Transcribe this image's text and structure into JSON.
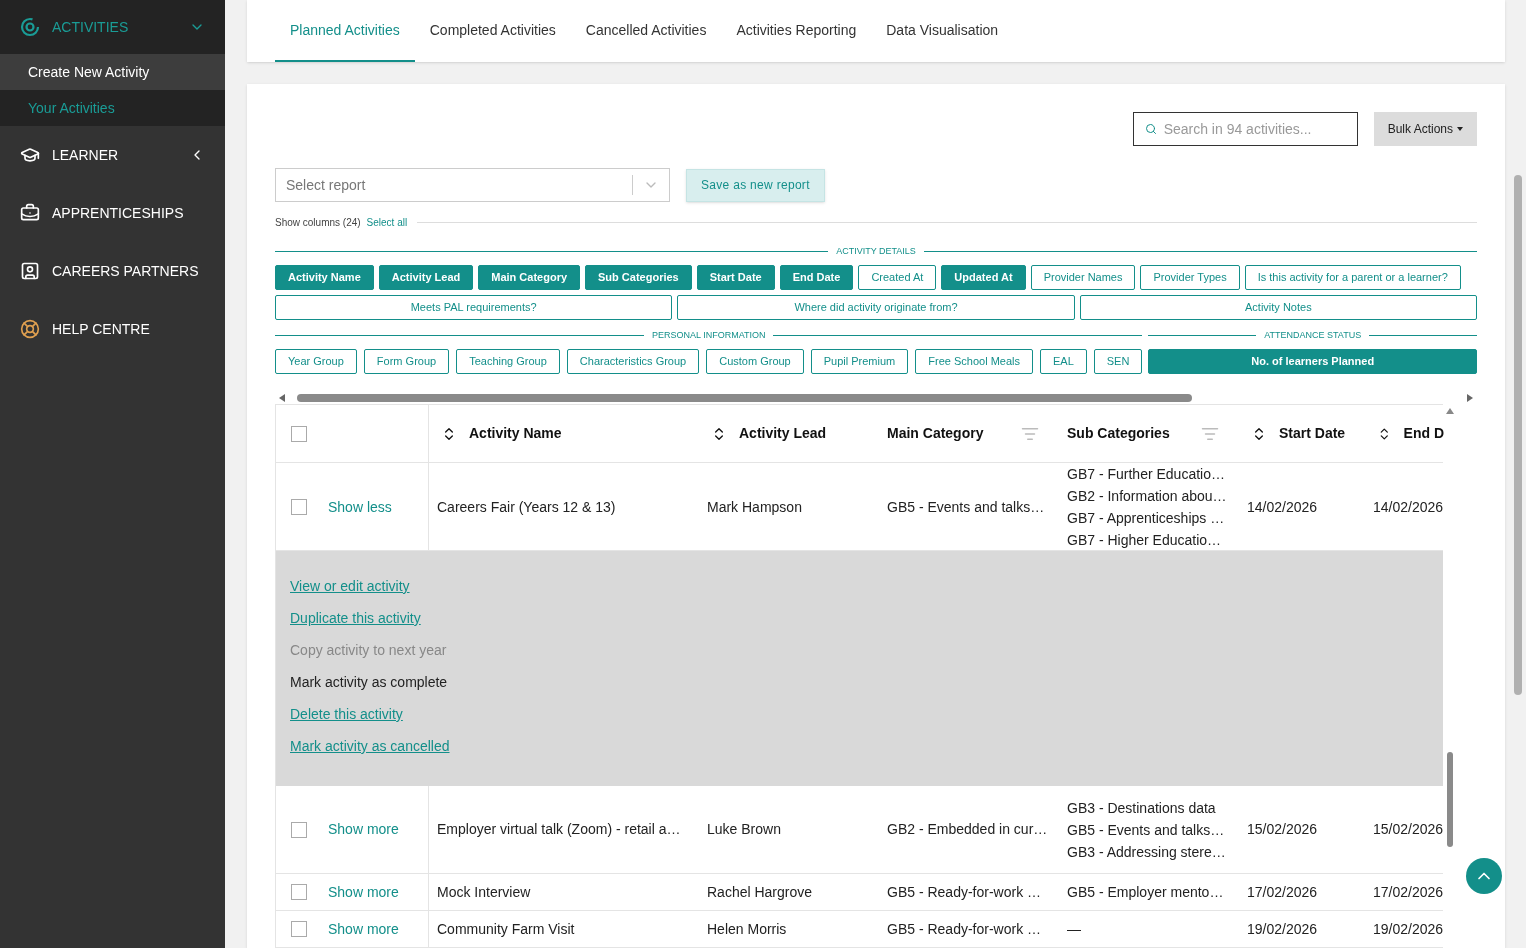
{
  "sidebar": {
    "sections": [
      {
        "label": "ACTIVITIES",
        "kind": "activities",
        "expanded": true,
        "children": [
          {
            "label": "Create New Activity",
            "selected": false
          },
          {
            "label": "Your Activities",
            "selected": true
          }
        ]
      },
      {
        "label": "LEARNER",
        "kind": "learner",
        "expanded": false
      },
      {
        "label": "APPRENTICESHIPS",
        "kind": "apprenticeships"
      },
      {
        "label": "CAREERS PARTNERS",
        "kind": "partners"
      },
      {
        "label": "HELP CENTRE",
        "kind": "help"
      }
    ]
  },
  "tabs": [
    {
      "label": "Planned Activities",
      "selected": true
    },
    {
      "label": "Completed Activities",
      "selected": false
    },
    {
      "label": "Cancelled Activities",
      "selected": false
    },
    {
      "label": "Activities Reporting",
      "selected": false
    },
    {
      "label": "Data Visualisation",
      "selected": false
    }
  ],
  "search": {
    "placeholder": "Search in 94 activities..."
  },
  "bulk_actions": "Bulk Actions",
  "report_select": {
    "placeholder": "Select report"
  },
  "save_report": "Save as new report",
  "show_columns": {
    "label": "Show columns (24)",
    "select_all": "Select all"
  },
  "column_groups": [
    {
      "title": "ACTIVITY DETAILS",
      "rows": [
        {
          "chips": [
            {
              "label": "Activity Name",
              "selected": true
            },
            {
              "label": "Activity Lead",
              "selected": true
            },
            {
              "label": "Main Category",
              "selected": true
            },
            {
              "label": "Sub Categories",
              "selected": true
            },
            {
              "label": "Start Date",
              "selected": true
            },
            {
              "label": "End Date",
              "selected": true
            },
            {
              "label": "Created At",
              "selected": false
            },
            {
              "label": "Updated At",
              "selected": true
            },
            {
              "label": "Provider Names",
              "selected": false
            },
            {
              "label": "Provider Types",
              "selected": false
            },
            {
              "label": "Is this activity for a parent or a learner?",
              "selected": false
            }
          ]
        },
        {
          "chips": [
            {
              "label": "Meets PAL requirements?",
              "selected": false
            },
            {
              "label": "Where did activity originate from?",
              "selected": false
            },
            {
              "label": "Activity Notes",
              "selected": false
            }
          ]
        }
      ]
    },
    {
      "title": "PERSONAL INFORMATION",
      "rows": [
        {
          "chips": [
            {
              "label": "Year Group",
              "selected": false
            },
            {
              "label": "Form Group",
              "selected": false
            },
            {
              "label": "Teaching Group",
              "selected": false
            },
            {
              "label": "Characteristics Group",
              "selected": false
            },
            {
              "label": "Custom Group",
              "selected": false
            },
            {
              "label": "Pupil Premium",
              "selected": false
            },
            {
              "label": "Free School Meals",
              "selected": false
            },
            {
              "label": "EAL",
              "selected": false
            },
            {
              "label": "SEN",
              "selected": false
            }
          ]
        }
      ]
    },
    {
      "title": "ATTENDANCE STATUS",
      "rows": [
        {
          "chips": [
            {
              "label": "No. of learners Planned",
              "selected": true
            }
          ]
        }
      ]
    }
  ],
  "table": {
    "select_all_checked": false,
    "columns": [
      {
        "label": "Activity Name",
        "kind": "sort"
      },
      {
        "label": "Activity Lead",
        "kind": "sort"
      },
      {
        "label": "Main Category",
        "kind": "filter"
      },
      {
        "label": "Sub Categories",
        "kind": "filter"
      },
      {
        "label": "Start Date",
        "kind": "sort"
      },
      {
        "label": "End D",
        "kind": "sort"
      }
    ],
    "rows": [
      {
        "checked": false,
        "toggle": "Show less",
        "cells": [
          "Careers Fair (Years 12 & 13)",
          "Mark Hampson",
          "GB5 - Events and talks…",
          [
            "GB7 - Further Educatio…",
            "GB2 - Information abou…",
            "GB7 - Apprenticeships …",
            "GB7 - Higher Educatio…"
          ],
          "14/02/2026",
          "14/02/2026"
        ],
        "actions": [
          {
            "label": "View or edit activity",
            "kind": "link"
          },
          {
            "label": "Duplicate this activity",
            "kind": "link"
          },
          {
            "label": "Copy activity to next year",
            "kind": "disabled"
          },
          {
            "label": "Mark activity as complete",
            "kind": "plain"
          },
          {
            "label": "Delete this activity",
            "kind": "link"
          },
          {
            "label": "Mark activity as cancelled",
            "kind": "link"
          }
        ]
      },
      {
        "checked": false,
        "toggle": "Show more",
        "cells": [
          "Employer virtual talk (Zoom) - retail a…",
          "Luke Brown",
          "GB2 - Embedded in cur…",
          [
            "GB3 - Destinations data",
            "GB5 - Events and talks…",
            "GB3 - Addressing stere…"
          ],
          "15/02/2026",
          "15/02/2026"
        ]
      },
      {
        "checked": false,
        "toggle": "Show more",
        "cells": [
          "Mock Interview",
          "Rachel Hargrove",
          "GB5 - Ready-for-work …",
          [
            "GB5 - Employer mento…"
          ],
          "17/02/2026",
          "17/02/2026"
        ]
      },
      {
        "checked": false,
        "toggle": "Show more",
        "cells": [
          "Community Farm Visit",
          "Helen Morris",
          "GB5 - Ready-for-work …",
          [
            "—"
          ],
          "19/02/2026",
          "19/02/2026"
        ]
      }
    ]
  }
}
